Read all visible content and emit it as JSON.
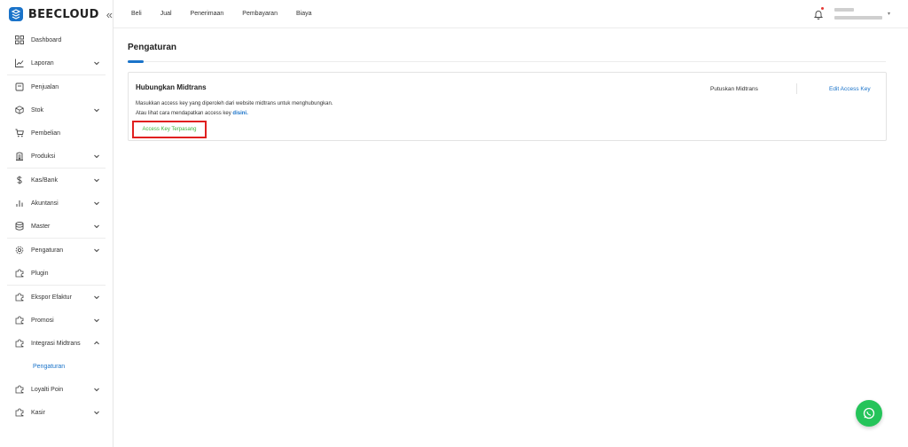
{
  "brand": {
    "name": "BEECLOUD",
    "collapse_glyph": "«"
  },
  "sidebar": {
    "items": [
      {
        "label": "Dashboard",
        "icon": "grid-icon",
        "expandable": false
      },
      {
        "label": "Laporan",
        "icon": "chart-line-icon",
        "expandable": true
      },
      {
        "label": "Penjualan",
        "icon": "receipt-icon",
        "expandable": false
      },
      {
        "label": "Stok",
        "icon": "box-icon",
        "expandable": true
      },
      {
        "label": "Pembelian",
        "icon": "cart-icon",
        "expandable": false
      },
      {
        "label": "Produksi",
        "icon": "factory-icon",
        "expandable": true
      },
      {
        "label": "Kas/Bank",
        "icon": "dollar-icon",
        "expandable": true
      },
      {
        "label": "Akuntansi",
        "icon": "bar-chart-icon",
        "expandable": true
      },
      {
        "label": "Master",
        "icon": "database-icon",
        "expandable": true
      },
      {
        "label": "Pengaturan",
        "icon": "gear-icon",
        "expandable": true
      },
      {
        "label": "Plugin",
        "icon": "puzzle-icon",
        "expandable": false
      },
      {
        "label": "Ekspor Efaktur",
        "icon": "puzzle-icon",
        "expandable": true
      },
      {
        "label": "Promosi",
        "icon": "puzzle-icon",
        "expandable": true
      },
      {
        "label": "Integrasi Midtrans",
        "icon": "puzzle-icon",
        "expandable": true,
        "expanded": true
      },
      {
        "label": "Loyalti Poin",
        "icon": "puzzle-icon",
        "expandable": true
      },
      {
        "label": "Kasir",
        "icon": "puzzle-icon",
        "expandable": true
      }
    ],
    "sub_item": {
      "label": "Pengaturan"
    }
  },
  "topbar": {
    "menu": [
      "Beli",
      "Jual",
      "Penerimaan",
      "Pembayaran",
      "Biaya"
    ],
    "caret": "▾"
  },
  "main": {
    "title": "Pengaturan",
    "card": {
      "title": "Hubungkan Midtrans",
      "desc_line1": "Masukkan access key yang diperoleh dari website midtrans untuk menghubungkan.",
      "desc_line2_prefix": "Atau lihat cara mendapatkan access key ",
      "desc_line2_link": "disini.",
      "status": "Access Key Terpasang",
      "action_disconnect": "Putuskan Midtrans",
      "action_edit": "Edit Access Key"
    }
  },
  "colors": {
    "accent": "#1a73c9",
    "status_green": "#3cb43c",
    "highlight_red": "#e02020",
    "whatsapp": "#25c45a"
  }
}
